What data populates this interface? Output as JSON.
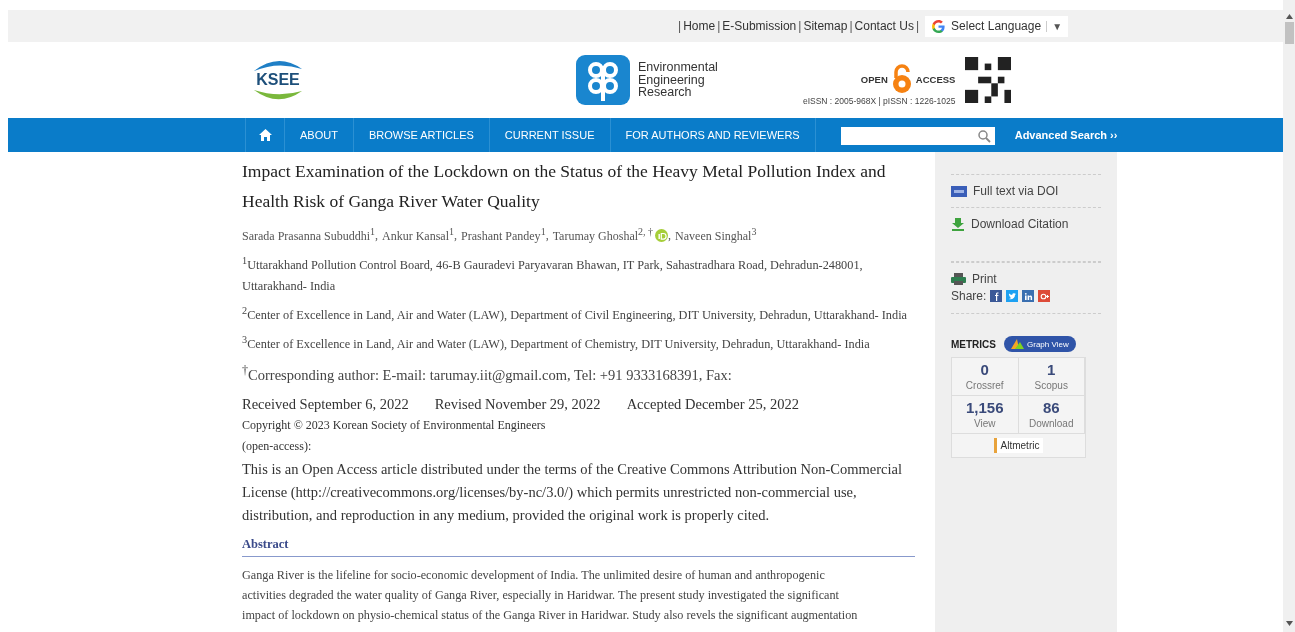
{
  "top_links": [
    "Home",
    "E-Submission",
    "Sitemap",
    "Contact Us"
  ],
  "top_separator": "|",
  "language": {
    "label": "Select Language",
    "arrow": "▼"
  },
  "logo": {
    "text": "KSEE"
  },
  "journal": {
    "name_lines": [
      "Environmental",
      "Engineering",
      "Research"
    ]
  },
  "open_access": {
    "left": "OPEN",
    "right": "ACCESS",
    "issn": "eISSN : 2005-968X | pISSN : 1226-1025"
  },
  "nav": {
    "items": [
      "ABOUT",
      "BROWSE ARTICLES",
      "CURRENT ISSUE",
      "FOR AUTHORS AND REVIEWERS"
    ],
    "advanced_search": "Advanced Search ››"
  },
  "article": {
    "title": "Impact Examination of the Lockdown on the Status of the Heavy Metal Pollution Index and Health Risk of Ganga River Water Quality",
    "authors": [
      {
        "name": "Sarada Prasanna Subuddhi$^{1}$",
        "orcid": false,
        "separator": ","
      },
      {
        "name": "Ankur Kansal$^{1}$",
        "orcid": false,
        "separator": ","
      },
      {
        "name": "Prashant Pandey$^{1}$",
        "orcid": false,
        "separator": ","
      },
      {
        "name": "Tarumay Ghoshal$^{2, †}$",
        "orcid": true,
        "separator": ","
      },
      {
        "name": "Naveen Singhal$^{3}$",
        "orcid": false
      }
    ],
    "affiliations": [
      "$^{1}$Uttarakhand Pollution Control Board, 46-B Gauradevi Paryavaran Bhawan, IT Park, Sahastradhara Road, Dehradun-248001, Uttarakhand- India",
      "$^{2}$Center of Excellence in Land, Air and Water (LAW), Department of Civil Engineering, DIT University, Dehradun, Uttarakhand- India",
      "$^{3}$Center of Excellence in Land, Air and Water (LAW), Department of Chemistry, DIT University, Dehradun, Uttarakhand- India"
    ],
    "corresponding": "$^{†}$Corresponding author: E-mail: tarumay.iit@gmail.com, Tel: +91 9333168391, Fax:",
    "dates": [
      "Received September 6, 2022",
      "Revised November 29, 2022",
      "Accepted December 25, 2022"
    ],
    "copyright": "Copyright © 2023 Korean Society of Environmental Engineers",
    "open_access_note": "(open-access):",
    "license": "This is an Open Access article distributed under the terms of the Creative Commons Attribution Non-Commercial License (http://creativecommons.org/licenses/by-nc/3.0/) which permits unrestricted non-commercial use, distribution, and reproduction in any medium, provided the original work is properly cited.",
    "abstract_heading": "Abstract",
    "abstract_lines": [
      "Ganga River is the lifeline for socio-economic development of India. The unlimited desire of human and anthropogenic",
      "activities degraded the water quality of Ganga River, especially in Haridwar. The present study investigated the significant",
      "impact of lockdown on physio-chemical status of the Ganga River in Haridwar. Study also revels the significant augmentation"
    ]
  },
  "sidebar": {
    "links": [
      {
        "kind": "doi",
        "label": "Full text via DOI"
      },
      {
        "kind": "download",
        "label": "Download Citation"
      },
      {
        "kind": "print",
        "label": "Print"
      }
    ],
    "share_label": "Share:",
    "share": [
      {
        "kind": "facebook",
        "color": "#3b5998"
      },
      {
        "kind": "twitter",
        "color": "#1da1f2"
      },
      {
        "kind": "linkedin",
        "color": "#3a6fb0"
      },
      {
        "kind": "google",
        "color": "#dd4b39"
      }
    ],
    "metrics_label": "METRICS",
    "graph_view": "Graph View",
    "metrics": [
      {
        "value": "0",
        "label": "Crossref"
      },
      {
        "value": "1",
        "label": "Scopus"
      },
      {
        "value": "1,156",
        "label": "View"
      },
      {
        "value": "86",
        "label": "Download"
      }
    ],
    "altmetric": "Altmetric"
  }
}
